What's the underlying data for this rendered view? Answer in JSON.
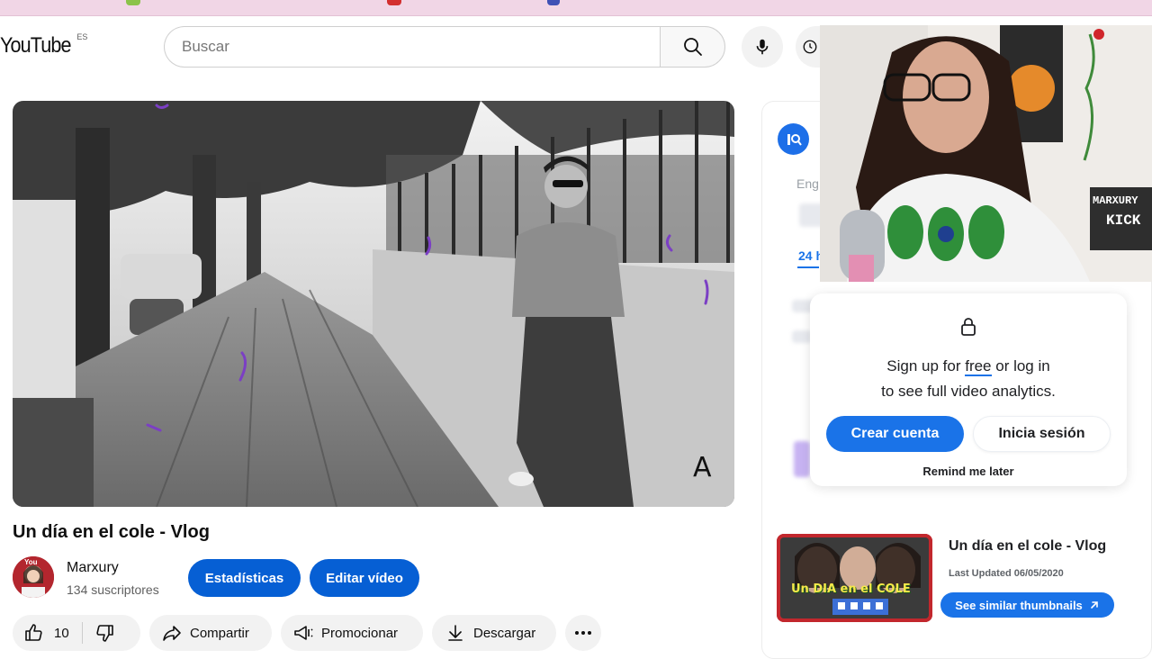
{
  "header": {
    "logo_text": "YouTube",
    "logo_country": "ES",
    "search_placeholder": "Buscar"
  },
  "video": {
    "title": "Un día en el cole - Vlog",
    "overlay_letter": "A"
  },
  "channel": {
    "name": "Marxury",
    "subscribers": "134 suscriptores",
    "avatar_text": "You"
  },
  "owner_buttons": {
    "stats": "Estadísticas",
    "edit": "Editar vídeo"
  },
  "actions": {
    "likes": "10",
    "share": "Compartir",
    "promote": "Promocionar",
    "download": "Descargar"
  },
  "side_panel": {
    "faded_lang": "Eng",
    "faded_tab": "24 h",
    "signup_line1_prefix": "Sign up for ",
    "signup_line1_free": "free",
    "signup_line1_suffix": " or log in",
    "signup_line2": "to see full video analytics.",
    "create_account": "Crear cuenta",
    "login": "Inicia sesión",
    "remind": "Remind me later",
    "related_title": "Un día en el cole - Vlog",
    "last_updated": "Last Updated 06/05/2020",
    "similar_button": "See similar thumbnails",
    "thumb_text": "Un DIA en el COLE"
  },
  "webcam": {
    "sign_line1": "MARXURY",
    "sign_line2": "KICK"
  },
  "colors": {
    "youtube_blue": "#065fd4",
    "accent_blue": "#1a73e8",
    "browser_strip": "#f1d6e6"
  }
}
